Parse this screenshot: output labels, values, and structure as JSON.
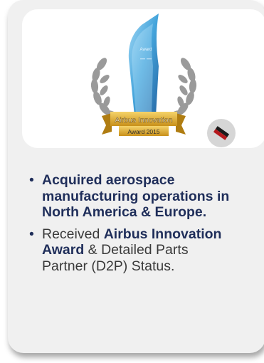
{
  "card": {
    "image": {
      "alt_icon": "trophy-award-image",
      "ribbon_line1": "Airbus Innovation",
      "ribbon_line2": "Award 2015",
      "trophy_text_1": "Award",
      "badge_icon": "flag-icon"
    },
    "bullets": [
      {
        "parts": [
          {
            "text": "Acquired aerospace manufacturing operations in North America & Europe.",
            "bold": true
          }
        ]
      },
      {
        "parts": [
          {
            "text": "Received ",
            "bold": false
          },
          {
            "text": "Airbus Innovation Award",
            "bold": true
          },
          {
            "text": " & Detailed Parts Partner (D2P) Status.",
            "bold": false
          }
        ]
      }
    ]
  },
  "colors": {
    "card_bg": "#f0f0f0",
    "text_dark": "#1f2e5a",
    "text_body": "#3a3a3a",
    "gold": "#e3b233",
    "badge_red": "#b5181c"
  }
}
